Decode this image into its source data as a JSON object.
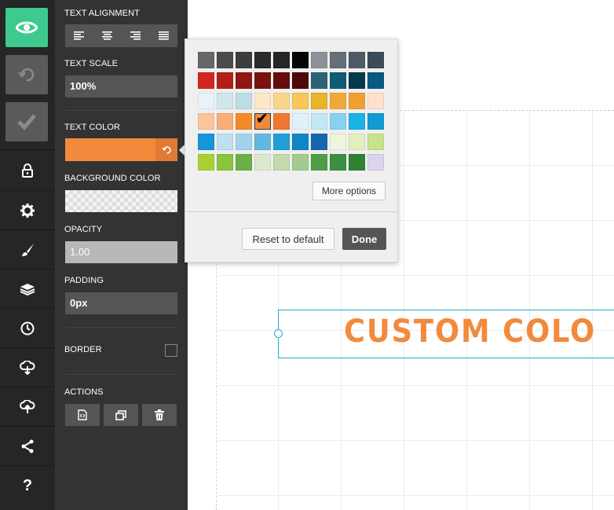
{
  "rail": {
    "items": [
      "eye-icon",
      "undo-icon",
      "check-icon",
      "lock-icon",
      "gear-icon",
      "brush-icon",
      "layers-icon",
      "clock-icon",
      "cloud-download-icon",
      "cloud-upload-icon",
      "share-icon",
      "help-icon"
    ],
    "help_label": "?"
  },
  "panel": {
    "text_alignment_label": "TEXT ALIGNMENT",
    "text_scale_label": "TEXT SCALE",
    "text_scale_value": "100%",
    "text_color_label": "TEXT COLOR",
    "text_color_value": "#f28a3c",
    "background_color_label": "BACKGROUND COLOR",
    "opacity_label": "OPACITY",
    "opacity_value": "1.00",
    "padding_label": "PADDING",
    "padding_value": "0px",
    "border_label": "BORDER",
    "actions_label": "ACTIONS"
  },
  "canvas": {
    "text": "CUSTOM COLO",
    "text_color": "#f28a3c"
  },
  "popover": {
    "palette": [
      [
        "#676767",
        "#4b4b4b",
        "#3d3d3d",
        "#2b2b2b",
        "#262626",
        "#050505",
        "#8c9297",
        "#666f78",
        "#505a66",
        "#3e4b58"
      ],
      [
        "#d0261d",
        "#b21f18",
        "#911812",
        "#7b120d",
        "#650d0a",
        "#4e0806",
        "#2a6474",
        "#0e5c73",
        "#05394c",
        "#075a82"
      ],
      [
        "#e8f3f7",
        "#d0e6eb",
        "#bcdde6",
        "#fde7c4",
        "#fbd589",
        "#f9c65c",
        "#eab42a",
        "#f2a73a",
        "#f0a032",
        "#fee1cc"
      ],
      [
        "#fbc49d",
        "#f8ae75",
        "#f28a28",
        "#f28a3c",
        "#ef7732",
        "#dff2f9",
        "#c1e8f5",
        "#86d2ef",
        "#1ab2e9",
        "#139ad3"
      ],
      [
        "#1695d8",
        "#bfe0ef",
        "#a2d2ee",
        "#62b8e2",
        "#1f9fd6",
        "#0f87c6",
        "#1566b1",
        "#eef5df",
        "#e1eebe",
        "#c9e28d"
      ],
      [
        "#a8d233",
        "#8ac43c",
        "#69b04a",
        "#d9e8cf",
        "#c1dab0",
        "#a3cb8f",
        "#4f9e47",
        "#3b8f42",
        "#2e8232",
        "#dcd3ec"
      ]
    ],
    "selected_color": "#f28a3c",
    "more_options_label": "More options",
    "reset_label": "Reset to default",
    "done_label": "Done"
  }
}
